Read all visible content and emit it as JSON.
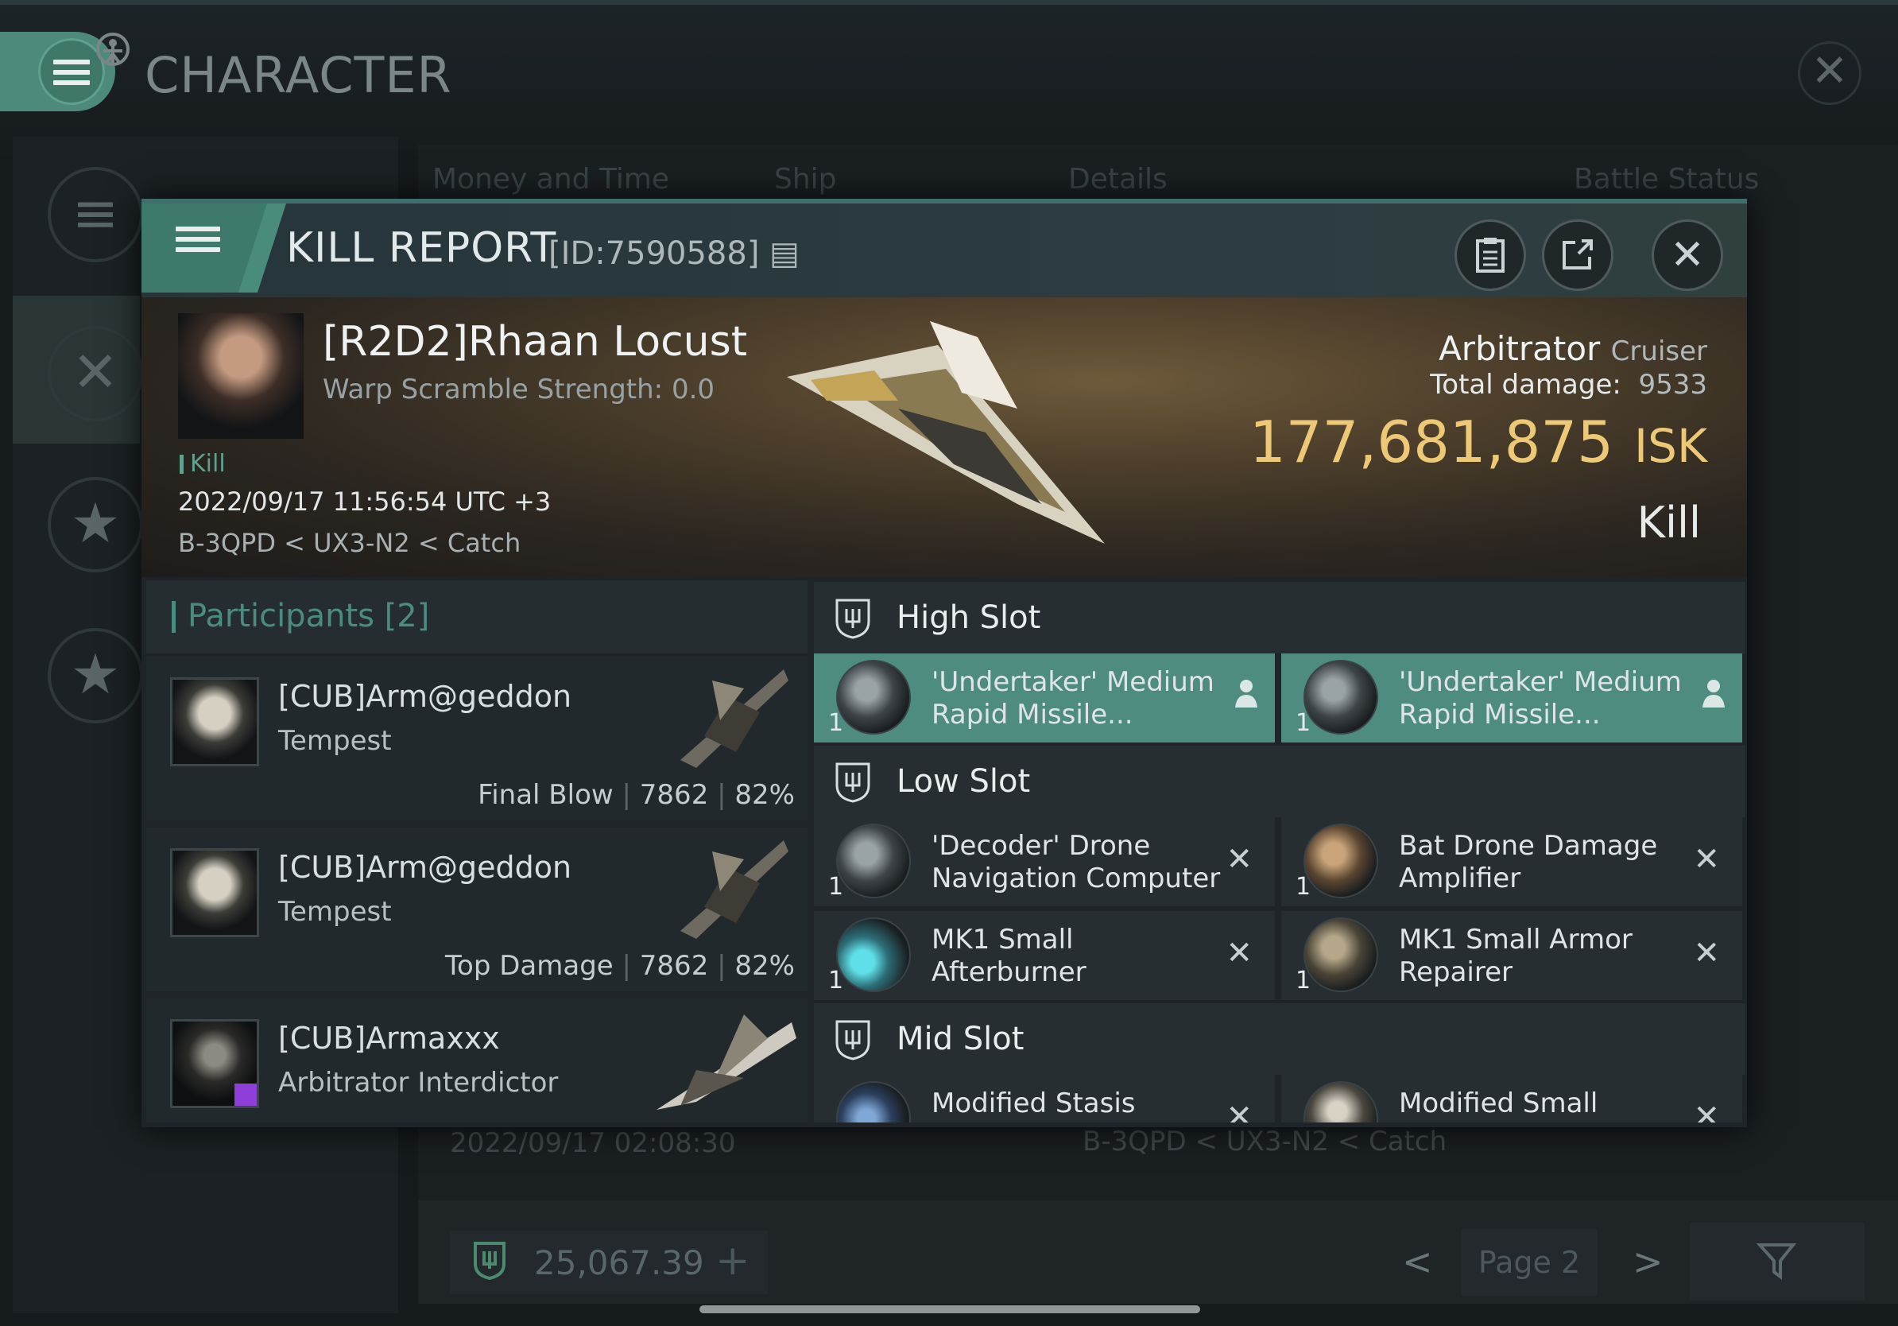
{
  "app": {
    "title": "CHARACTER",
    "close_glyph": "✕"
  },
  "background": {
    "tabs": [
      "Money and Time",
      "Ship",
      "Details",
      "Battle Status"
    ],
    "row_date": "2022/09/17  02:08:30",
    "row_location": "B-3QPD < UX3-N2 < Catch",
    "wallet_value": "25,067.39",
    "wallet_plus": "+",
    "page_label": "Page 2",
    "prev_glyph": "<",
    "next_glyph": ">"
  },
  "dialog": {
    "title": "KILL REPORT",
    "id": "[ID:7590588]",
    "copy_glyph": "▤",
    "close_glyph": "✕",
    "victim": {
      "name": "[R2D2]Rhaan Locust",
      "warp_scramble": "Warp Scramble Strength: 0.0",
      "tag": "Kill",
      "date": "2022/09/17 11:56:54 UTC +3",
      "location": "B-3QPD < UX3-N2 < Catch",
      "ship_name": "Arbitrator",
      "ship_class": "Cruiser",
      "total_damage_label": "Total damage:",
      "total_damage": "9533",
      "isk_value": "177,681,875",
      "isk_unit": "ISK",
      "result": "Kill"
    },
    "participants": {
      "label": "Participants [2]",
      "rows": [
        {
          "name": "[CUB]Arm@geddon",
          "ship": "Tempest",
          "role": "Final Blow",
          "damage": "7862",
          "percent": "82%"
        },
        {
          "name": "[CUB]Arm@geddon",
          "ship": "Tempest",
          "role": "Top Damage",
          "damage": "7862",
          "percent": "82%"
        },
        {
          "name": "[CUB]Armaxxx",
          "ship": "Arbitrator Interdictor",
          "role": "",
          "damage": "",
          "percent": ""
        }
      ]
    },
    "slots": {
      "high": {
        "label": "High Slot",
        "modules": [
          {
            "name": "'Undertaker' Medium Rapid Missile...",
            "qty": "1"
          },
          {
            "name": "'Undertaker' Medium Rapid Missile...",
            "qty": "1"
          }
        ]
      },
      "low": {
        "label": "Low Slot",
        "modules": [
          {
            "name": "'Decoder' Drone Navigation Computer",
            "qty": "1"
          },
          {
            "name": "Bat Drone Damage Amplifier",
            "qty": "1"
          },
          {
            "name": "MK1 Small Afterburner",
            "qty": "1"
          },
          {
            "name": "MK1 Small Armor Repairer",
            "qty": "1"
          }
        ]
      },
      "mid": {
        "label": "Mid Slot",
        "modules": [
          {
            "name": "Modified Stasis",
            "qty": ""
          },
          {
            "name": "Modified Small",
            "qty": ""
          }
        ]
      }
    }
  },
  "colors": {
    "accent": "#4d8c7f",
    "isk": "#ecc877"
  }
}
